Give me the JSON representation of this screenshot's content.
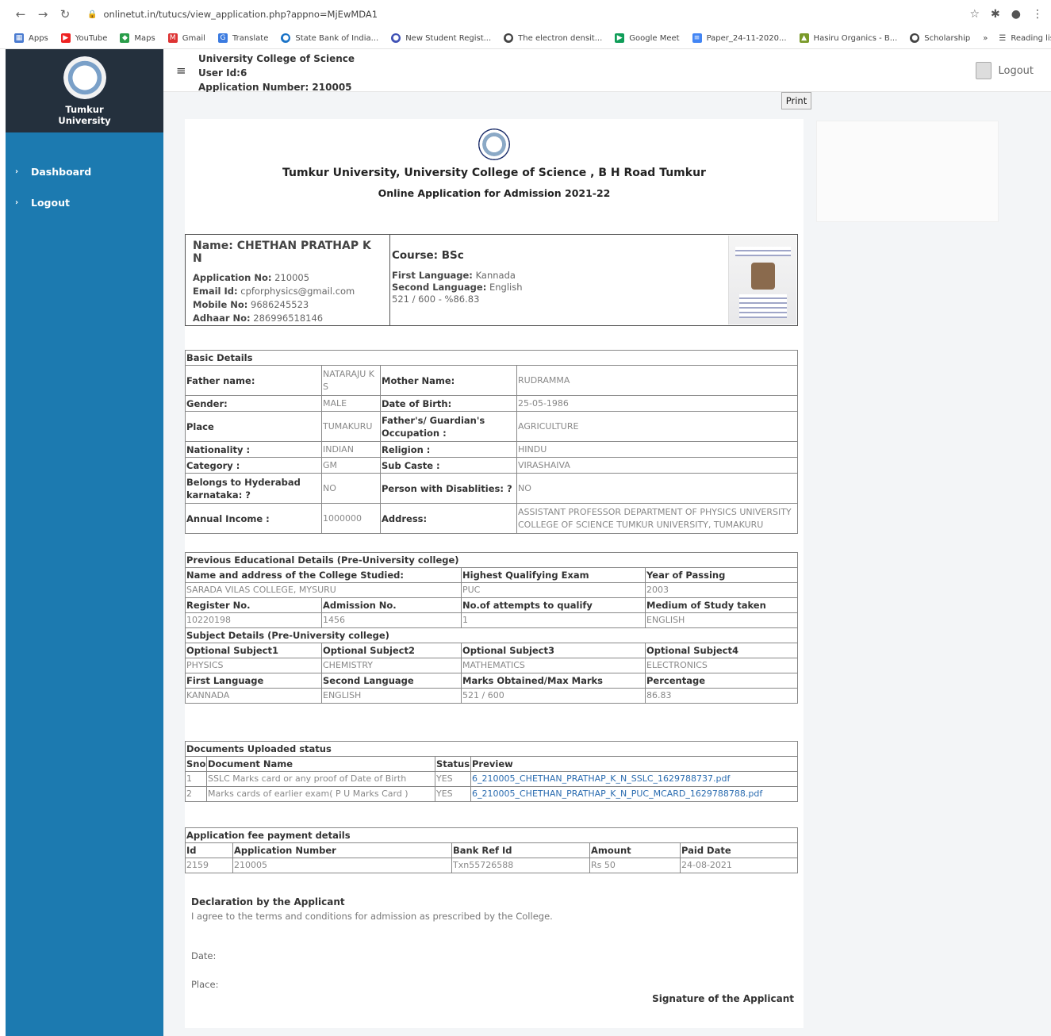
{
  "browser": {
    "url": "onlinetut.in/tutucs/view_application.php?appno=MjEwMDA1",
    "bookmarks": [
      "Apps",
      "YouTube",
      "Maps",
      "Gmail",
      "Translate",
      "State Bank of India...",
      "New Student Regist...",
      "The electron densit...",
      "Google Meet",
      "Paper_24-11-2020...",
      "Hasiru Organics - B...",
      "Scholarship"
    ],
    "more": "»",
    "reading_list": "Reading list"
  },
  "sidebar": {
    "logo_text": "Tumkur University",
    "items": [
      {
        "label": "Dashboard"
      },
      {
        "label": "Logout"
      }
    ]
  },
  "header": {
    "college": "University College of Science",
    "user_id": "User Id:6",
    "app_number": "Application Number: 210005",
    "logout": "Logout",
    "print": "Print"
  },
  "document": {
    "title": "Tumkur University, University College of Science , B H Road Tumkur",
    "subtitle": "Online Application for Admission 2021-22",
    "profile": {
      "name": "Name: CHETHAN PRATHAP K N",
      "app_no_label": "Application No:",
      "app_no": "210005",
      "email_label": "Email Id:",
      "email": "cpforphysics@gmail.com",
      "mobile_label": "Mobile No:",
      "mobile": "9686245523",
      "adhaar_label": "Adhaar No:",
      "adhaar": "286996518146",
      "course": "Course: BSc",
      "first_lang_label": "First Language:",
      "first_lang": "Kannada",
      "second_lang_label": "Second Language:",
      "second_lang": "English",
      "marks": "521 / 600 - %86.83"
    },
    "basic": {
      "title": "Basic Details",
      "rows": [
        [
          "Father name:",
          "NATARAJU K S",
          "Mother Name:",
          "RUDRAMMA"
        ],
        [
          "Gender:",
          "MALE",
          "Date of Birth:",
          "25-05-1986"
        ],
        [
          "Place",
          "TUMAKURU",
          "Father's/ Guardian's Occupation :",
          "AGRICULTURE"
        ],
        [
          "Nationality :",
          "INDIAN",
          "Religion :",
          "HINDU"
        ],
        [
          "Category :",
          "GM",
          "Sub Caste :",
          "VIRASHAIVA"
        ],
        [
          "Belongs to Hyderabad karnataka: ?",
          "NO",
          "Person with Disablities: ?",
          "NO"
        ],
        [
          "Annual Income :",
          "1000000",
          "Address:",
          "ASSISTANT PROFESSOR DEPARTMENT OF PHYSICS UNIVERSITY COLLEGE OF SCIENCE TUMKUR UNIVERSITY, TUMAKURU"
        ]
      ]
    },
    "prev_edu": {
      "title": "Previous Educational Details (Pre-University college)",
      "h1": [
        "Name and address of the College Studied:",
        "Highest Qualifying Exam",
        "Year of Passing"
      ],
      "v1": [
        "SARADA VILAS COLLEGE, MYSURU",
        "PUC",
        "2003"
      ],
      "h2": [
        "Register No.",
        "Admission No.",
        "No.of attempts to qualify",
        "Medium of Study taken"
      ],
      "v2": [
        "10220198",
        "1456",
        "1",
        "ENGLISH"
      ],
      "subj_title": "Subject Details (Pre-University college)",
      "h3": [
        "Optional Subject1",
        "Optional Subject2",
        "Optional Subject3",
        "Optional Subject4"
      ],
      "v3": [
        "PHYSICS",
        "CHEMISTRY",
        "MATHEMATICS",
        "ELECTRONICS"
      ],
      "h4": [
        "First Language",
        "Second Language",
        "Marks Obtained/Max Marks",
        "Percentage"
      ],
      "v4": [
        "KANNADA",
        "ENGLISH",
        "521 / 600",
        "86.83"
      ]
    },
    "docs": {
      "title": "Documents Uploaded status",
      "headers": [
        "Sno",
        "Document Name",
        "Status",
        "Preview"
      ],
      "rows": [
        [
          "1",
          "SSLC Marks card or any proof of Date of Birth",
          "YES",
          "6_210005_CHETHAN_PRATHAP_K_N_SSLC_1629788737.pdf"
        ],
        [
          "2",
          "Marks cards of earlier exam( P U Marks Card )",
          "YES",
          "6_210005_CHETHAN_PRATHAP_K_N_PUC_MCARD_1629788788.pdf"
        ]
      ]
    },
    "fee": {
      "title": "Application fee payment details",
      "headers": [
        "Id",
        "Application Number",
        "Bank Ref Id",
        "Amount",
        "Paid Date"
      ],
      "row": [
        "2159",
        "210005",
        "Txn55726588",
        "Rs 50",
        "24-08-2021"
      ]
    },
    "declaration": {
      "title": "Declaration by the Applicant",
      "text": "I agree to the terms and conditions for admission as prescribed by the College.",
      "date": "Date:",
      "place": "Place:",
      "signature": "Signature of the Applicant"
    }
  }
}
